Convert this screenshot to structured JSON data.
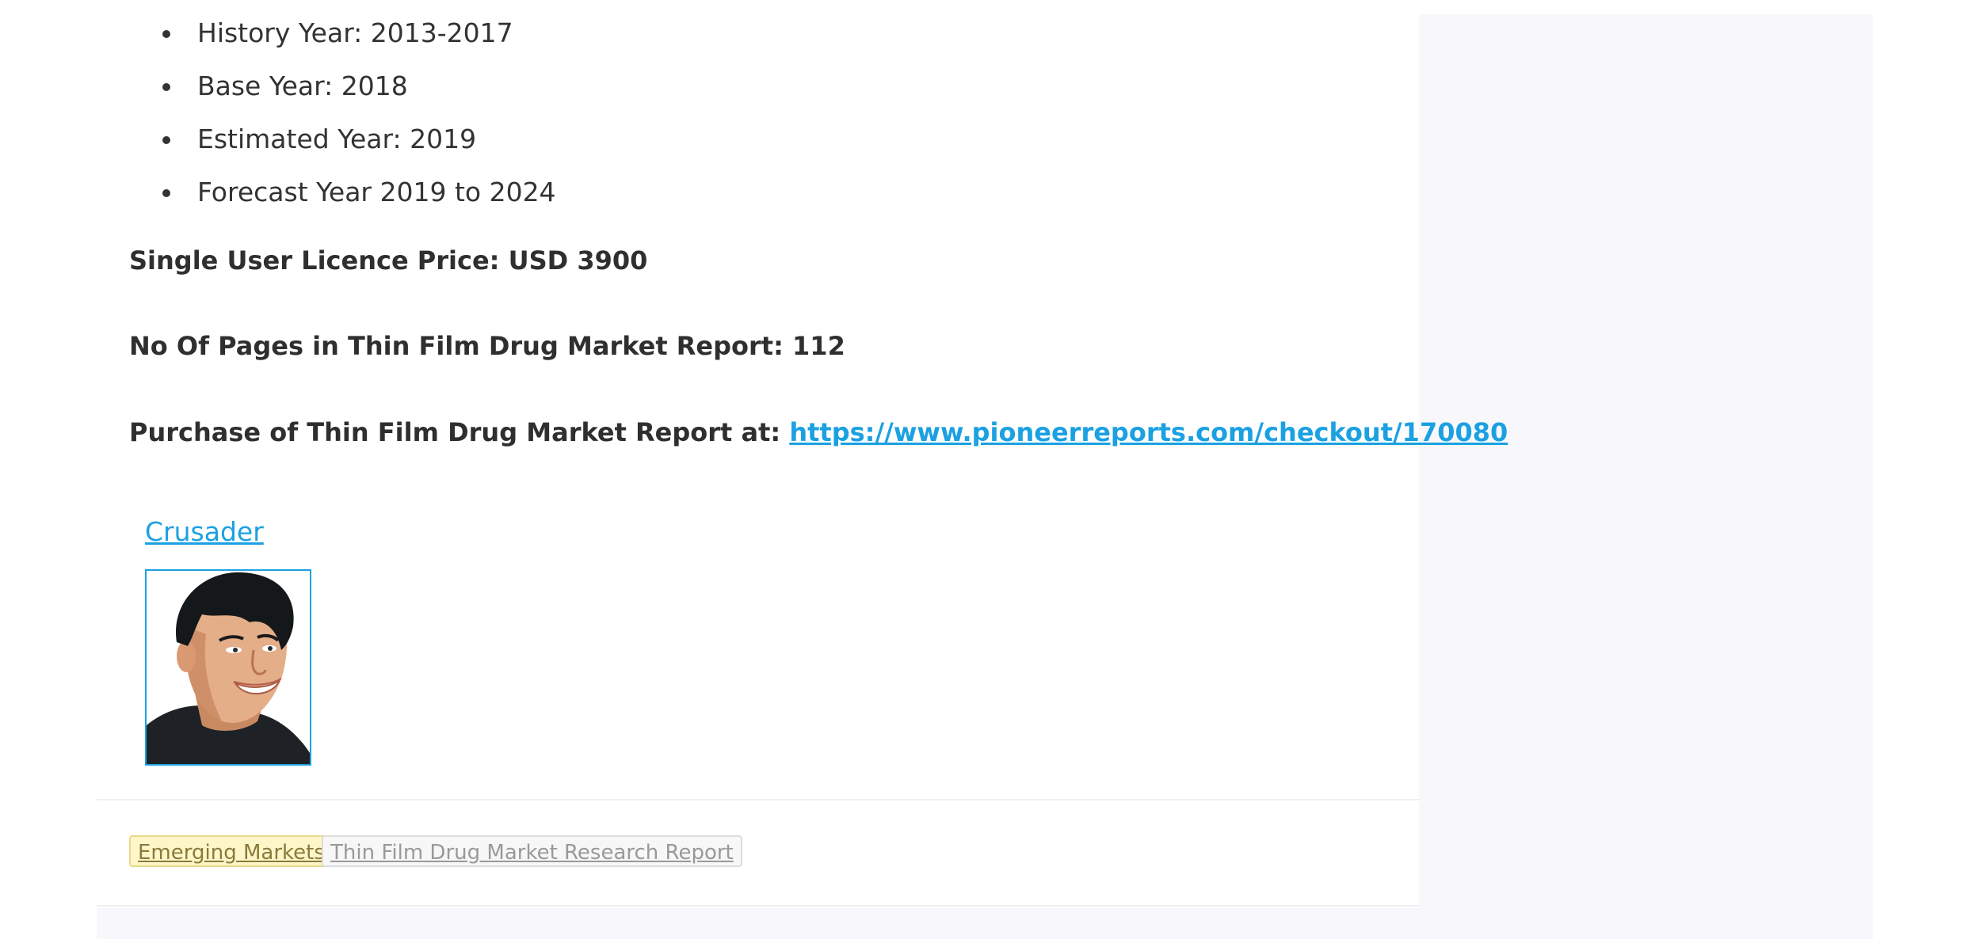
{
  "report_details": {
    "bullets": [
      "History Year: 2013-2017",
      "Base Year: 2018",
      "Estimated Year: 2019",
      "Forecast Year 2019 to 2024"
    ],
    "price_line": "Single User Licence Price: USD 3900",
    "pages_line": "No Of Pages in Thin Film Drug Market Report: 112",
    "purchase_prefix": "Purchase of Thin Film Drug Market Report at: ",
    "purchase_link": "https://www.pioneerreports.com/checkout/170080"
  },
  "author": {
    "name": "Crusader",
    "avatar_icon": "cartoon-man-avatar-icon"
  },
  "tags": [
    {
      "label": "Emerging Markets",
      "color": "#fdf6c8"
    },
    {
      "label": "Thin Film Drug Market Research Report",
      "color": "#f7f7f7"
    }
  ],
  "colors": {
    "link": "#1ba1e2",
    "sidebar_bg": "#f8f8fc"
  }
}
